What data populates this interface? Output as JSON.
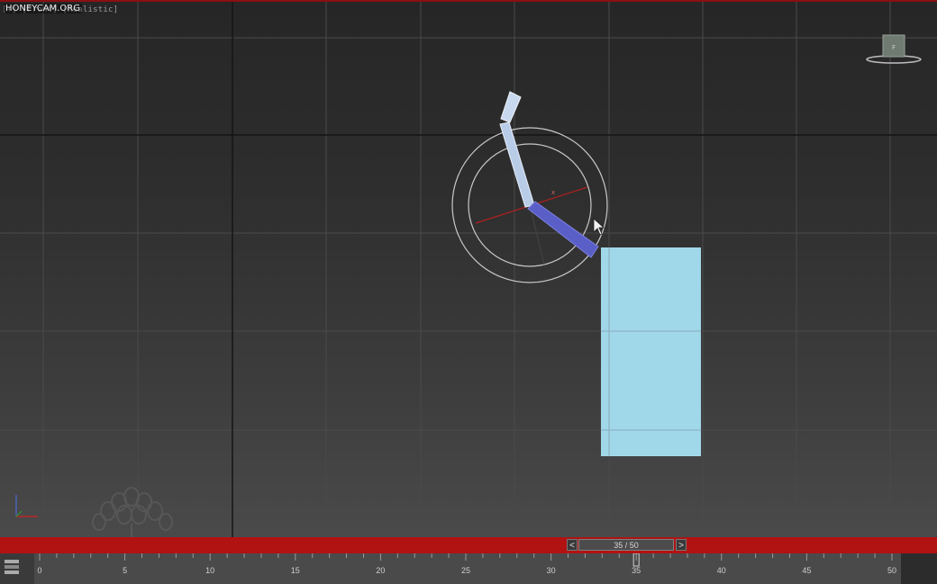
{
  "viewport": {
    "label": "[+] [Front] [Realistic]",
    "watermark": "HONEYCAM.ORG"
  },
  "timeline": {
    "slider_label": "35 / 50",
    "prev_label": "<",
    "next_label": ">",
    "ruler_labels": [
      "0",
      "5",
      "10",
      "15",
      "20",
      "25",
      "30",
      "35",
      "40",
      "45",
      "50"
    ]
  },
  "colors": {
    "upper_bone": "#b8cce8",
    "lower_bone": "#5a5fc8",
    "box": "#a0d8ea",
    "frame_bar": "#b11212"
  },
  "icons": {
    "viewcube": "viewcube-icon",
    "cursor": "cursor-icon",
    "axis": "axis-tripod-icon",
    "logo": "tree-logo-icon"
  }
}
